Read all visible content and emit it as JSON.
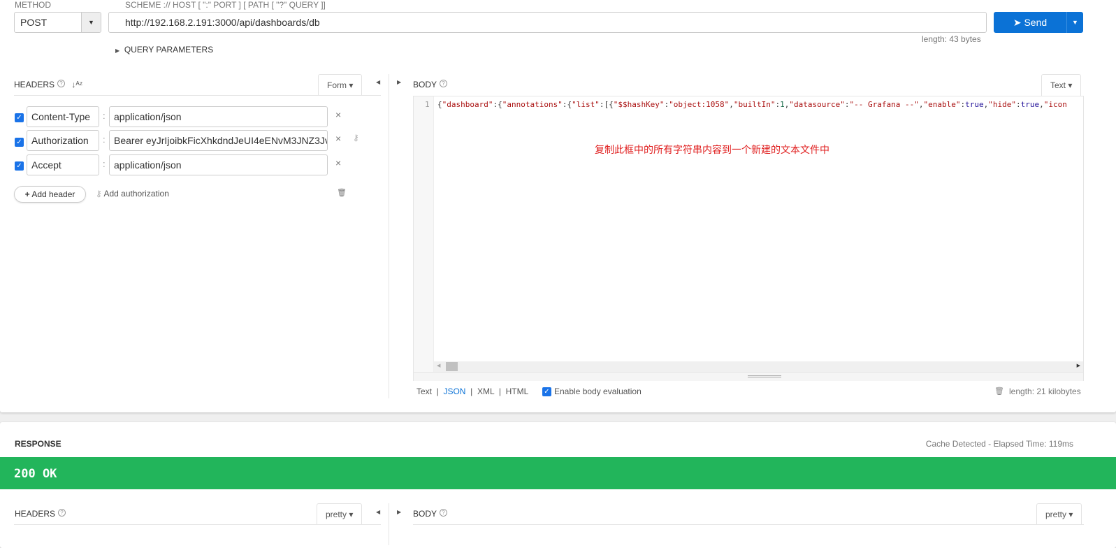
{
  "request": {
    "method_label": "METHOD",
    "method": "POST",
    "url_label": "SCHEME :// HOST [ \":\" PORT ] [ PATH [ \"?\" QUERY ]]",
    "url": "http://192.168.2.191:3000/api/dashboards/db",
    "length": "length: 43 bytes",
    "send": "Send",
    "query_params": "QUERY PARAMETERS"
  },
  "headers": {
    "title": "HEADERS",
    "mode": "Form",
    "items": [
      {
        "name": "Content-Type",
        "value": "application/json"
      },
      {
        "name": "Authorization",
        "value": "Bearer eyJrIjoibkFicXhkdndJeUI4eENvM3JNZ3Jv"
      },
      {
        "name": "Accept",
        "value": "application/json"
      }
    ],
    "add_header": "Add header",
    "add_auth": "Add authorization"
  },
  "body": {
    "title": "BODY",
    "mode": "Text",
    "line_no": "1",
    "tokens": [
      [
        "p",
        "{"
      ],
      [
        "k",
        "\"dashboard\""
      ],
      [
        "p",
        ":{"
      ],
      [
        "k",
        "\"annotations\""
      ],
      [
        "p",
        ":{"
      ],
      [
        "k",
        "\"list\""
      ],
      [
        "p",
        ":[{"
      ],
      [
        "k",
        "\"$$hashKey\""
      ],
      [
        "p",
        ":"
      ],
      [
        "s",
        "\"object:1058\""
      ],
      [
        "p",
        ","
      ],
      [
        "k",
        "\"builtIn\""
      ],
      [
        "p",
        ":"
      ],
      [
        "n",
        "1"
      ],
      [
        "p",
        ","
      ],
      [
        "k",
        "\"datasource\""
      ],
      [
        "p",
        ":"
      ],
      [
        "s",
        "\"-- Grafana --\""
      ],
      [
        "p",
        ","
      ],
      [
        "k",
        "\"enable\""
      ],
      [
        "p",
        ":"
      ],
      [
        "b",
        "true"
      ],
      [
        "p",
        ","
      ],
      [
        "k",
        "\"hide\""
      ],
      [
        "p",
        ":"
      ],
      [
        "b",
        "true"
      ],
      [
        "p",
        ","
      ],
      [
        "k",
        "\"icon"
      ]
    ],
    "annotation": "复制此框中的所有字符串内容到一个新建的文本文件中",
    "formats": [
      "Text",
      "JSON",
      "XML",
      "HTML"
    ],
    "active_format": "JSON",
    "eval_label": "Enable body evaluation",
    "length": "length: 21 kilobytes"
  },
  "response": {
    "title": "RESPONSE",
    "timing": "Cache Detected - Elapsed Time: 119ms",
    "status": "200 OK",
    "status_color": "#22b55b",
    "headers_title": "HEADERS",
    "headers_mode": "pretty",
    "body_title": "BODY",
    "body_mode": "pretty"
  },
  "colors": {
    "accent": "#0b72d6",
    "annotation": "#e02020"
  }
}
